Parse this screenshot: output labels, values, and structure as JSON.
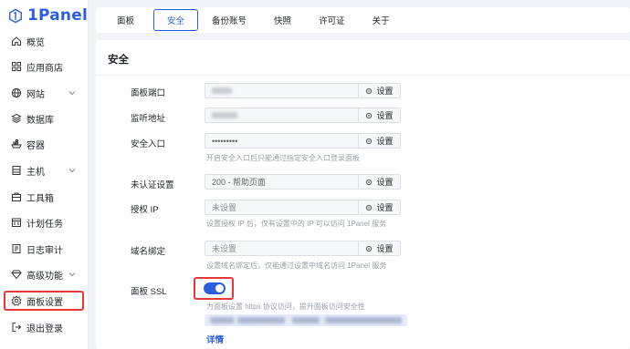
{
  "app": {
    "name": "1Panel",
    "brand_color": "#2b5ede",
    "alert_color": "#e5393a"
  },
  "sidebar": {
    "items": [
      {
        "label": "概览",
        "icon": "home-icon",
        "has_chevron": false
      },
      {
        "label": "应用商店",
        "icon": "apps-grid-icon",
        "has_chevron": false
      },
      {
        "label": "网站",
        "icon": "globe-icon",
        "has_chevron": true
      },
      {
        "label": "数据库",
        "icon": "database-layers-icon",
        "has_chevron": false
      },
      {
        "label": "容器",
        "icon": "container-ship-icon",
        "has_chevron": false
      },
      {
        "label": "主机",
        "icon": "host-server-icon",
        "has_chevron": true
      },
      {
        "label": "工具箱",
        "icon": "toolbox-icon",
        "has_chevron": false
      },
      {
        "label": "计划任务",
        "icon": "calendar-task-icon",
        "has_chevron": false
      },
      {
        "label": "日志审计",
        "icon": "log-audit-icon",
        "has_chevron": false
      },
      {
        "label": "高级功能",
        "icon": "diamond-icon",
        "has_chevron": true
      },
      {
        "label": "面板设置",
        "icon": "gear-icon",
        "has_chevron": false,
        "active": true
      },
      {
        "label": "退出登录",
        "icon": "logout-icon",
        "has_chevron": false
      }
    ]
  },
  "tabs": [
    {
      "label": "面板"
    },
    {
      "label": "安全",
      "active": true
    },
    {
      "label": "备份账号"
    },
    {
      "label": "快照"
    },
    {
      "label": "许可证"
    },
    {
      "label": "关于"
    }
  ],
  "security": {
    "title": "安全",
    "set_label": "设置",
    "fields": {
      "port": {
        "label": "面板端口",
        "value": ""
      },
      "listen_address": {
        "label": "监听地址",
        "value": ""
      },
      "security_entrance": {
        "label": "安全入口",
        "value": "•••••••••",
        "hint": "开启安全入口后只能通过指定安全入口登录面板"
      },
      "unauth_setting": {
        "label": "未认证设置",
        "value": "200 - 帮助页面"
      },
      "authorized_ip": {
        "label": "授权 IP",
        "placeholder": "未设置",
        "hint": "设置授权 IP 后，仅有设置中的 IP 可以访问 1Panel 服务"
      },
      "domain_binding": {
        "label": "域名绑定",
        "placeholder": "未设置",
        "hint": "设置域名绑定后，仅能通过设置中域名访问 1Panel 服务"
      },
      "panel_ssl": {
        "label": "面板 SSL",
        "enabled": true,
        "hint": "为面板设置 https 协议访问，提升面板访问安全性",
        "details_link": "详情"
      }
    }
  }
}
